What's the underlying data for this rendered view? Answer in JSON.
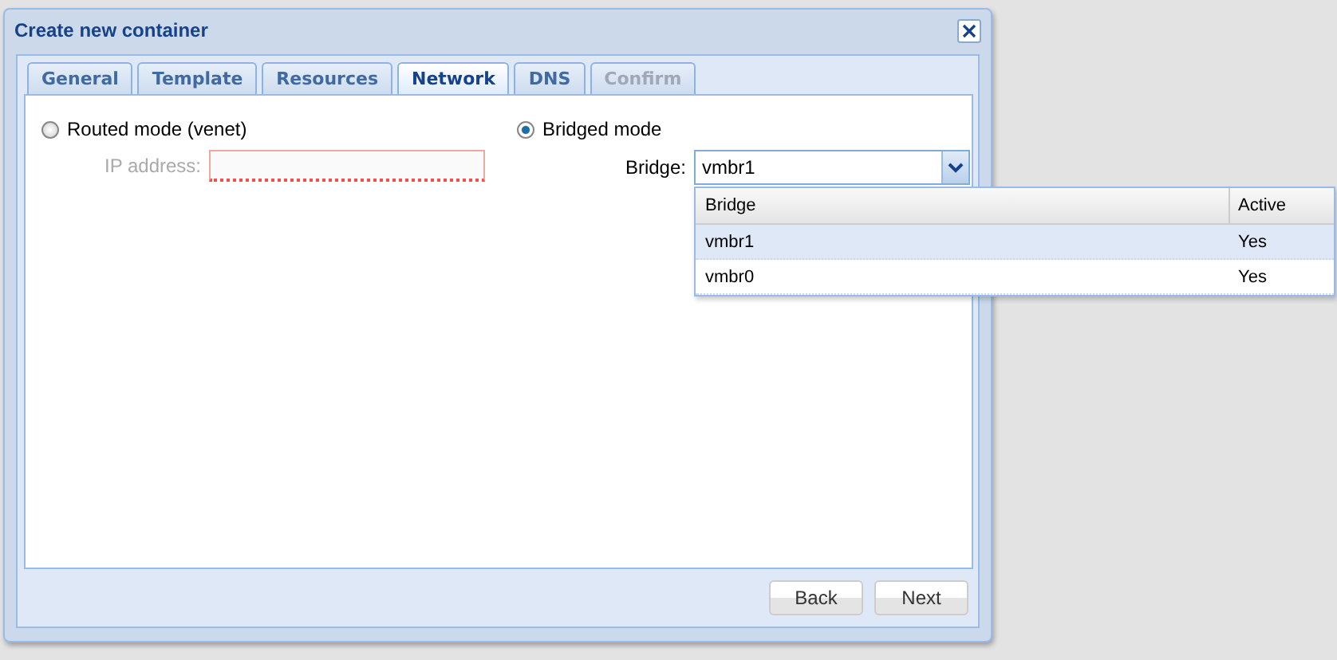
{
  "window": {
    "title": "Create new container"
  },
  "tabs": [
    {
      "label": "General",
      "selected": false,
      "disabled": false
    },
    {
      "label": "Template",
      "selected": false,
      "disabled": false
    },
    {
      "label": "Resources",
      "selected": false,
      "disabled": false
    },
    {
      "label": "Network",
      "selected": true,
      "disabled": false
    },
    {
      "label": "DNS",
      "selected": false,
      "disabled": false
    },
    {
      "label": "Confirm",
      "selected": false,
      "disabled": true
    }
  ],
  "modes": [
    {
      "label": "Routed mode (venet)",
      "selected": false,
      "field_label": "IP address:",
      "invalid": true
    },
    {
      "label": "Bridged mode",
      "selected": true,
      "field_label": "Bridge:",
      "field_value": "vmbr1",
      "invalid": false
    }
  ],
  "dropdown": {
    "columns": [
      "Bridge",
      "Active"
    ],
    "rows": [
      {
        "cells": [
          "vmbr1",
          "Yes"
        ],
        "selected": true
      },
      {
        "cells": [
          "vmbr0",
          "Yes"
        ],
        "selected": false
      }
    ]
  },
  "buttons": [
    "Back",
    "Next"
  ]
}
